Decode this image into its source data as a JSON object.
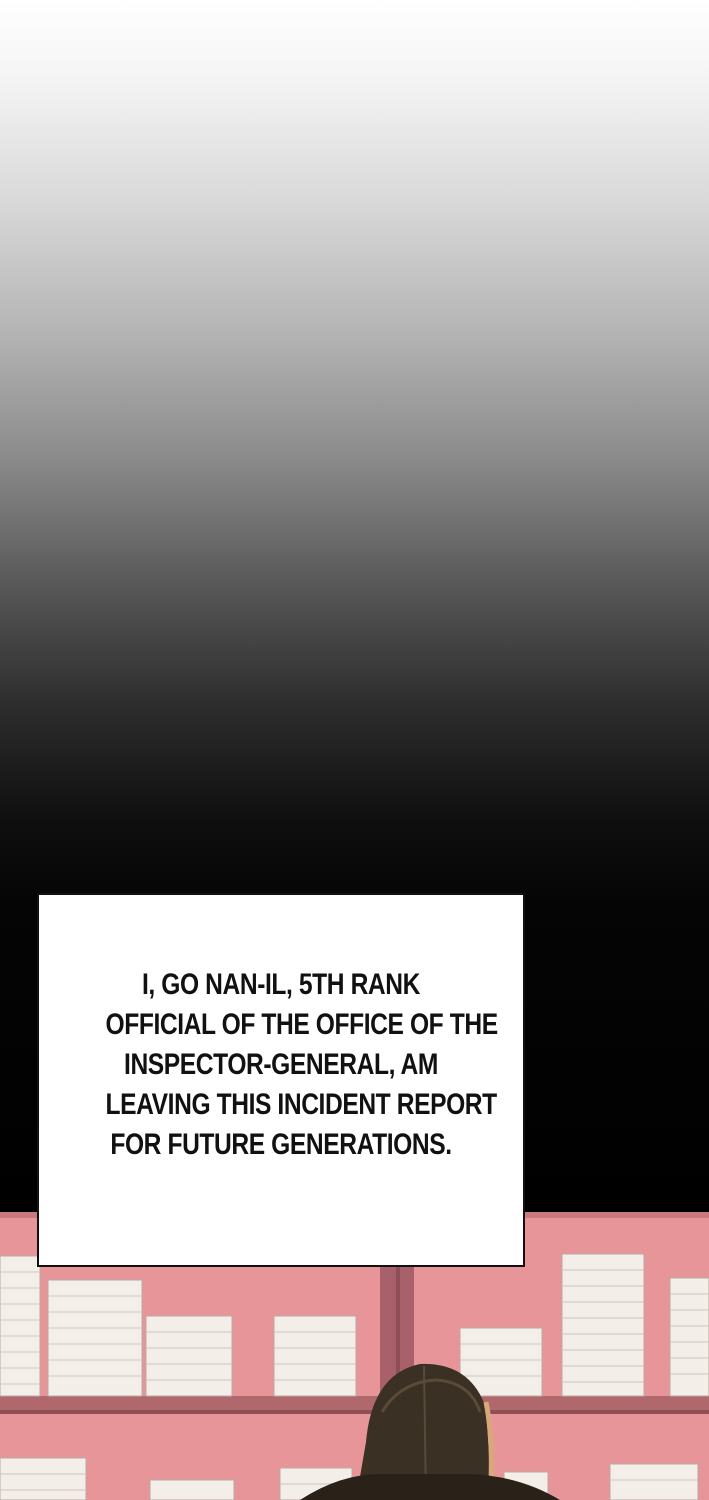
{
  "caption": {
    "lines": [
      "I, GO NAN-IL, 5TH RANK",
      "OFFICIAL OF THE OFFICE OF THE",
      "INSPECTOR-GENERAL, AM",
      "LEAVING THIS INCIDENT REPORT",
      "FOR FUTURE GENERATIONS."
    ]
  },
  "colors": {
    "wall_pink": "#e8959a",
    "shelf_board": "#b0686d",
    "hat": "#3a3024"
  }
}
